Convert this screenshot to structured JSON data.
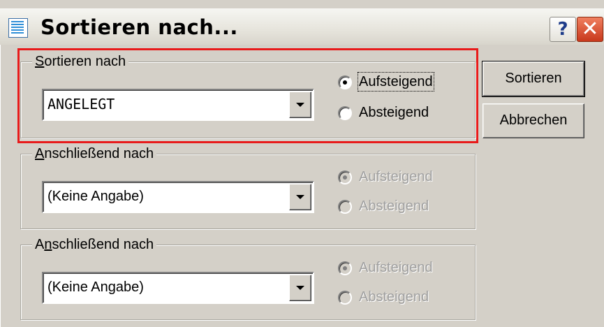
{
  "window": {
    "title": "Sortieren nach...",
    "help_label": "?",
    "close_label": "✕"
  },
  "groups": [
    {
      "legend_first": "S",
      "legend_rest": "ortieren nach",
      "combo_value": "ANGELEGT",
      "radio_ascending": "Aufsteigend",
      "radio_descending": "Absteigend",
      "enabled": true,
      "selected": "ascending"
    },
    {
      "legend_first": "A",
      "legend_rest": "nschließend nach",
      "combo_value": "(Keine Angabe)",
      "radio_ascending": "Aufsteigend",
      "radio_descending": "Absteigend",
      "enabled": false,
      "selected": "ascending"
    },
    {
      "legend_pre": "A",
      "legend_first": "n",
      "legend_rest": "schließend nach",
      "combo_value": "(Keine Angabe)",
      "radio_ascending": "Aufsteigend",
      "radio_descending": "Absteigend",
      "enabled": false,
      "selected": "ascending"
    }
  ],
  "buttons": {
    "sort_label": "Sortieren",
    "cancel_label": "Abbrechen"
  },
  "colors": {
    "highlight": "#e81b1b",
    "dialog_bg": "#d4d0c8"
  },
  "icons": {
    "app": "dialog-list-icon",
    "help": "help-icon",
    "close": "close-icon",
    "dropdown": "chevron-down-icon"
  }
}
